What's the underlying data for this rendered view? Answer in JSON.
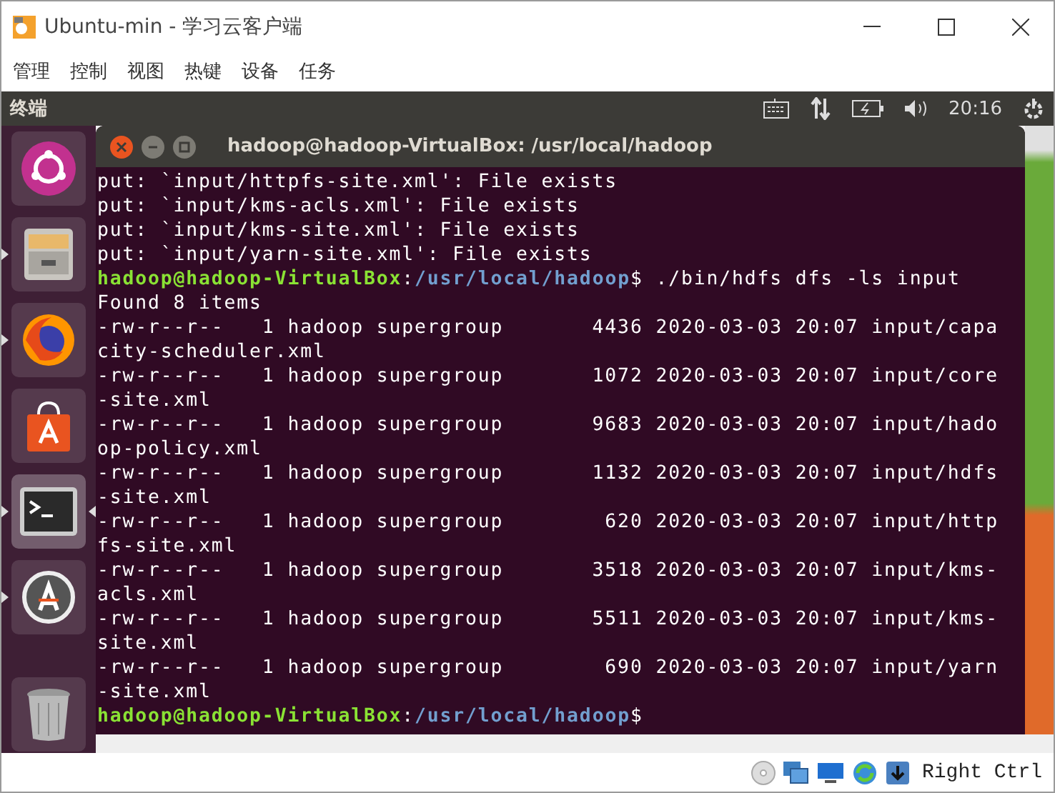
{
  "window": {
    "title": "Ubuntu-min - 学习云客户端"
  },
  "menu": [
    "管理",
    "控制",
    "视图",
    "热键",
    "设备",
    "任务"
  ],
  "panel": {
    "app_title": "终端",
    "clock": "20:16"
  },
  "launcher": [
    {
      "kind": "ubuntu",
      "running": false,
      "selected": false
    },
    {
      "kind": "files",
      "running": true,
      "selected": false
    },
    {
      "kind": "firefox",
      "running": true,
      "selected": false
    },
    {
      "kind": "software",
      "running": false,
      "selected": false
    },
    {
      "kind": "terminal",
      "running": true,
      "selected": true
    },
    {
      "kind": "updater",
      "running": true,
      "selected": false
    },
    {
      "kind": "trash",
      "running": false,
      "selected": false
    }
  ],
  "terminal": {
    "title": "hadoop@hadoop-VirtualBox: /usr/local/hadoop",
    "lines": [
      {
        "kind": "output",
        "text": "put: `input/httpfs-site.xml': File exists"
      },
      {
        "kind": "output",
        "text": "put: `input/kms-acls.xml': File exists"
      },
      {
        "kind": "output",
        "text": "put: `input/kms-site.xml': File exists"
      },
      {
        "kind": "output",
        "text": "put: `input/yarn-site.xml': File exists"
      },
      {
        "kind": "prompt",
        "user_host": "hadoop@hadoop-VirtualBox",
        "separator": ":",
        "path": "/usr/local/hadoop",
        "symbol": "$",
        "command": " ./bin/hdfs dfs -ls input"
      },
      {
        "kind": "output",
        "text": "Found 8 items"
      },
      {
        "kind": "output",
        "text": "-rw-r--r--   1 hadoop supergroup       4436 2020-03-03 20:07 input/capa"
      },
      {
        "kind": "output",
        "text": "city-scheduler.xml"
      },
      {
        "kind": "output",
        "text": "-rw-r--r--   1 hadoop supergroup       1072 2020-03-03 20:07 input/core"
      },
      {
        "kind": "output",
        "text": "-site.xml"
      },
      {
        "kind": "output",
        "text": "-rw-r--r--   1 hadoop supergroup       9683 2020-03-03 20:07 input/hado"
      },
      {
        "kind": "output",
        "text": "op-policy.xml"
      },
      {
        "kind": "output",
        "text": "-rw-r--r--   1 hadoop supergroup       1132 2020-03-03 20:07 input/hdfs"
      },
      {
        "kind": "output",
        "text": "-site.xml"
      },
      {
        "kind": "output",
        "text": "-rw-r--r--   1 hadoop supergroup        620 2020-03-03 20:07 input/http"
      },
      {
        "kind": "output",
        "text": "fs-site.xml"
      },
      {
        "kind": "output",
        "text": "-rw-r--r--   1 hadoop supergroup       3518 2020-03-03 20:07 input/kms-"
      },
      {
        "kind": "output",
        "text": "acls.xml"
      },
      {
        "kind": "output",
        "text": "-rw-r--r--   1 hadoop supergroup       5511 2020-03-03 20:07 input/kms-"
      },
      {
        "kind": "output",
        "text": "site.xml"
      },
      {
        "kind": "output",
        "text": "-rw-r--r--   1 hadoop supergroup        690 2020-03-03 20:07 input/yarn"
      },
      {
        "kind": "output",
        "text": "-site.xml"
      },
      {
        "kind": "prompt",
        "user_host": "hadoop@hadoop-VirtualBox",
        "separator": ":",
        "path": "/usr/local/hadoop",
        "symbol": "$"
      }
    ]
  },
  "status_bar": {
    "host_key": "Right Ctrl"
  }
}
